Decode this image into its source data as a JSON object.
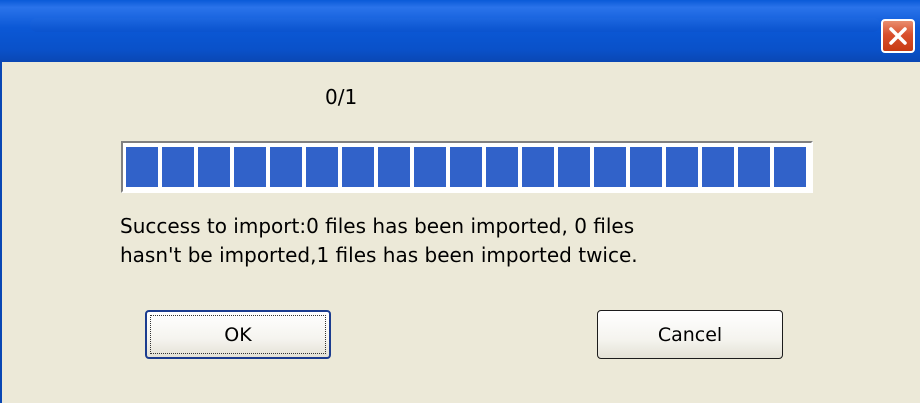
{
  "window": {
    "title": "",
    "close_icon": "close-icon",
    "close_color": "#d9502d",
    "titlebar_color": "#0a58d6",
    "background_color": "#ece9d8"
  },
  "progress": {
    "counter_text": "0/1",
    "fraction": 1.0,
    "bar_color": "#3162c9"
  },
  "message": {
    "line1": "Success to import:0 files has been imported, 0 files",
    "line2": "hasn't be imported,1 files has been imported twice."
  },
  "buttons": {
    "ok_label": "OK",
    "cancel_label": "Cancel"
  }
}
